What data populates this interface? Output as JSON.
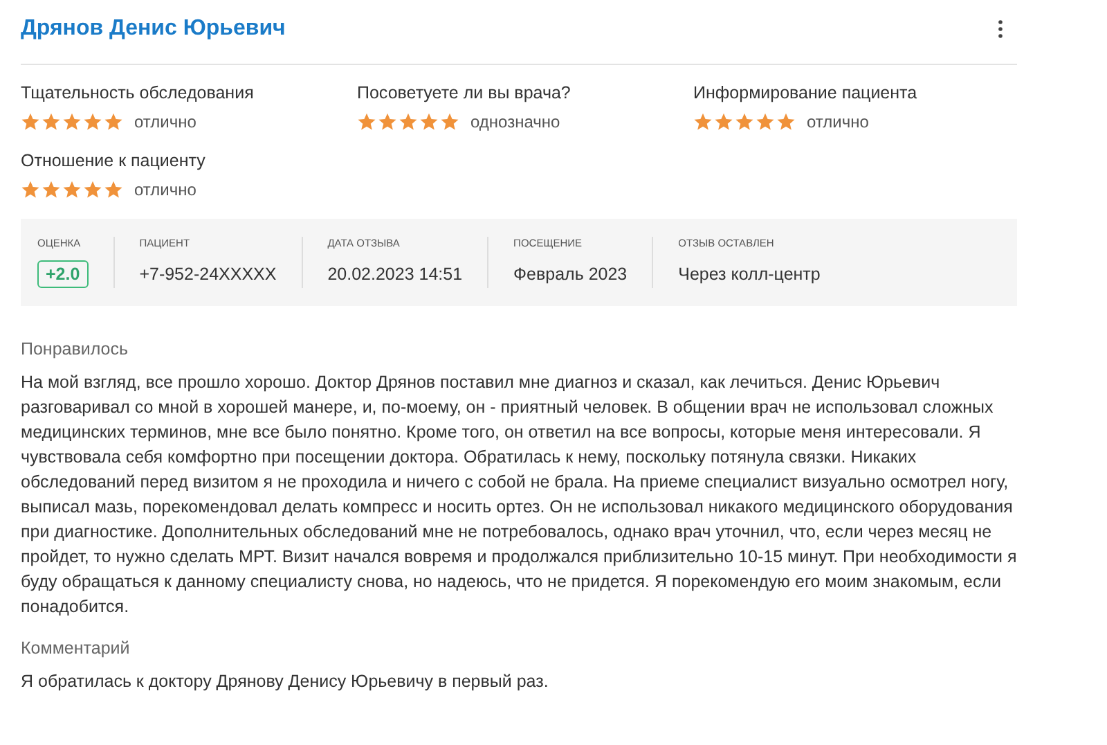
{
  "doctor": {
    "name": "Дрянов Денис Юрьевич"
  },
  "ratings": [
    {
      "label": "Тщательность обследования",
      "stars": 5,
      "verdict": "отлично"
    },
    {
      "label": "Посоветуете ли вы врача?",
      "stars": 5,
      "verdict": "однозначно"
    },
    {
      "label": "Информирование пациента",
      "stars": 5,
      "verdict": "отлично"
    },
    {
      "label": "Отношение к пациенту",
      "stars": 5,
      "verdict": "отлично"
    }
  ],
  "info": [
    {
      "kind": "score",
      "label": "ОЦЕНКА",
      "value": "+2.0"
    },
    {
      "kind": "text",
      "label": "ПАЦИЕНТ",
      "value": "+7-952-24XXXXX"
    },
    {
      "kind": "text",
      "label": "ДАТА ОТЗЫВА",
      "value": "20.02.2023 14:51"
    },
    {
      "kind": "text",
      "label": "ПОСЕЩЕНИЕ",
      "value": "Февраль 2023"
    },
    {
      "kind": "text",
      "label": "ОТЗЫВ ОСТАВЛЕН",
      "value": "Через колл-центр"
    }
  ],
  "sections": [
    {
      "heading": "Понравилось",
      "text": "На мой взгляд, все прошло хорошо. Доктор Дрянов поставил мне диагноз и сказал, как лечиться. Денис Юрьевич разговаривал со мной в хорошей манере, и, по-моему, он - приятный человек. В общении врач не использовал сложных медицинских терминов, мне все было понятно. Кроме того, он ответил на все вопросы, которые меня интересовали. Я чувствовала себя комфортно при посещении доктора. Обратилась к нему, поскольку потянула связки. Никаких обследований перед визитом я не проходила и ничего с собой не брала. На приеме специалист визуально осмотрел ногу, выписал мазь, порекомендовал делать компресс и носить ортез. Он не использовал никакого медицинского оборудования при диагностике. Дополнительных обследований мне не потребовалось, однако врач уточнил, что, если через месяц не пройдет, то нужно сделать МРТ. Визит начался вовремя и продолжался приблизительно 10-15 минут. При необходимости я буду обращаться к данному специалисту снова, но надеюсь, что не придется. Я порекомендую его моим знакомым, если понадобится."
    },
    {
      "heading": "Комментарий",
      "text": "Я обратилась к доктору Дрянову Денису Юрьевичу в первый раз."
    }
  ]
}
